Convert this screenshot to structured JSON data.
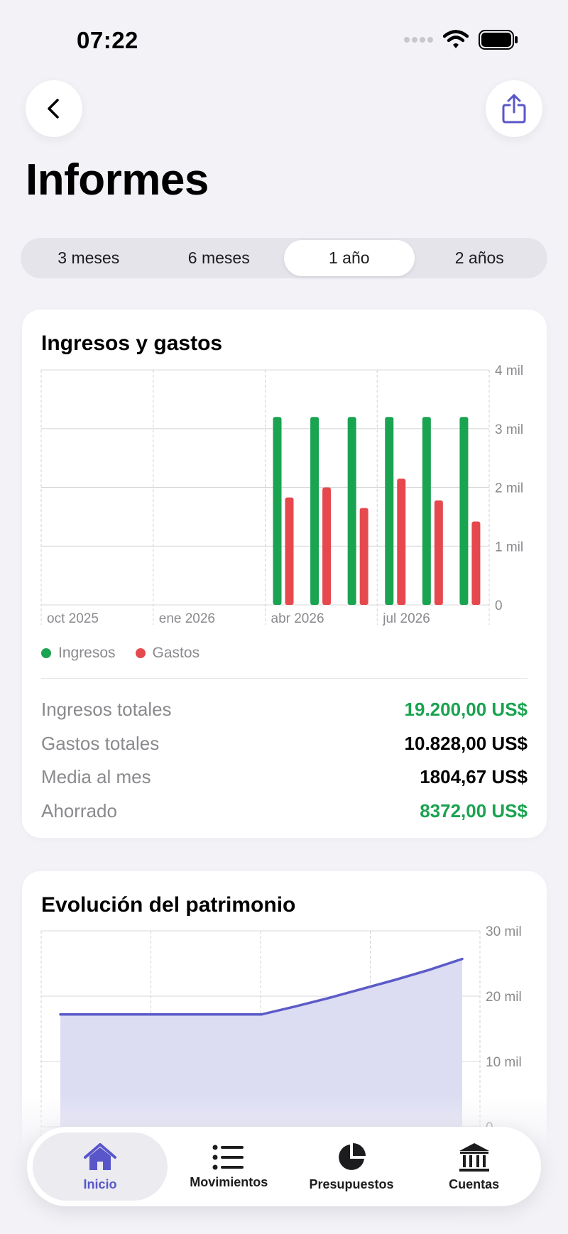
{
  "status": {
    "time": "07:22"
  },
  "header": {
    "title": "Informes"
  },
  "periods": [
    {
      "label": "3 meses",
      "active": false
    },
    {
      "label": "6 meses",
      "active": false
    },
    {
      "label": "1 año",
      "active": true
    },
    {
      "label": "2 años",
      "active": false
    }
  ],
  "income_card": {
    "title": "Ingresos y gastos",
    "legend": [
      {
        "label": "Ingresos",
        "color": "#1aa350"
      },
      {
        "label": "Gastos",
        "color": "#e5484d"
      }
    ],
    "summary": [
      {
        "label": "Ingresos totales",
        "value": "19.200,00 US$",
        "color": "#1aa350"
      },
      {
        "label": "Gastos totales",
        "value": "10.828,00 US$",
        "color": "#000000"
      },
      {
        "label": "Media al mes",
        "value": "1804,67 US$",
        "color": "#000000"
      },
      {
        "label": "Ahorrado",
        "value": "8372,00 US$",
        "color": "#1aa350"
      }
    ]
  },
  "net_worth_card": {
    "title": "Evolución del patrimonio"
  },
  "chart_data": [
    {
      "type": "bar",
      "title": "Ingresos y gastos",
      "x_tick_labels": [
        "oct 2025",
        "ene 2026",
        "abr 2026",
        "jul 2026"
      ],
      "y_tick_labels": [
        "0",
        "1 mil",
        "2 mil",
        "3 mil",
        "4 mil"
      ],
      "ylim": [
        0,
        4000
      ],
      "grid": true,
      "legend_position": "bottom-left",
      "categories": [
        "abr 2026",
        "may 2026",
        "jun 2026",
        "jul 2026",
        "ago 2026",
        "sep 2026"
      ],
      "series": [
        {
          "name": "Ingresos",
          "color": "#1aa350",
          "values": [
            3200,
            3200,
            3200,
            3200,
            3200,
            3200
          ]
        },
        {
          "name": "Gastos",
          "color": "#e5484d",
          "values": [
            1830,
            2000,
            1650,
            2150,
            1780,
            1420
          ]
        }
      ]
    },
    {
      "type": "area",
      "title": "Evolución del patrimonio",
      "y_tick_labels": [
        "0",
        "10 mil",
        "20 mil",
        "30 mil"
      ],
      "ylim": [
        0,
        30000
      ],
      "grid": true,
      "color": "#5b5bc8",
      "values": [
        17200,
        17200,
        17200,
        17200,
        17200,
        17200,
        17200,
        18400,
        19700,
        21100,
        22500,
        24000,
        25700
      ]
    }
  ],
  "tabbar": [
    {
      "label": "Inicio",
      "icon": "house-icon",
      "active": true
    },
    {
      "label": "Movimientos",
      "icon": "list-icon",
      "active": false
    },
    {
      "label": "Presupuestos",
      "icon": "pie-chart-icon",
      "active": false
    },
    {
      "label": "Cuentas",
      "icon": "bank-icon",
      "active": false
    }
  ]
}
